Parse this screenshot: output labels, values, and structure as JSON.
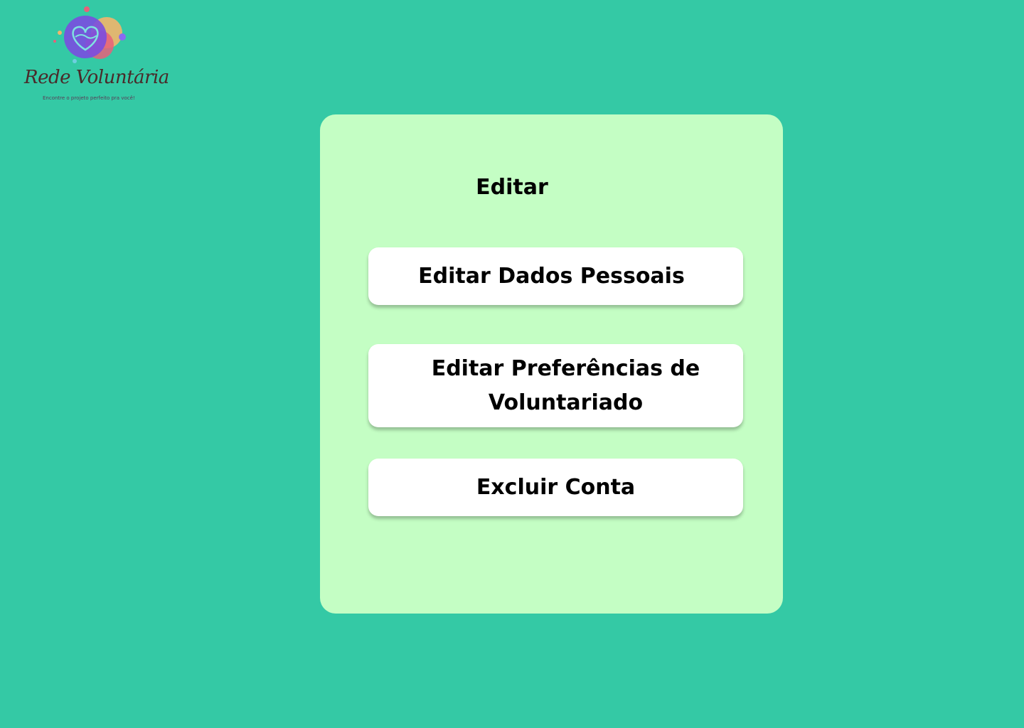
{
  "logo": {
    "name": "Rede Voluntária",
    "tagline": "Encontre o projeto perfeito pra você!"
  },
  "card": {
    "title": "Editar"
  },
  "options": [
    {
      "label": "Editar Dados Pessoais"
    },
    {
      "label": "Editar Preferências de Voluntariado"
    },
    {
      "label": "Excluir Conta"
    }
  ],
  "colors": {
    "background": "#34C9A5",
    "card": "#C4FEC4",
    "button": "#FFFFFF",
    "text": "#000000"
  }
}
